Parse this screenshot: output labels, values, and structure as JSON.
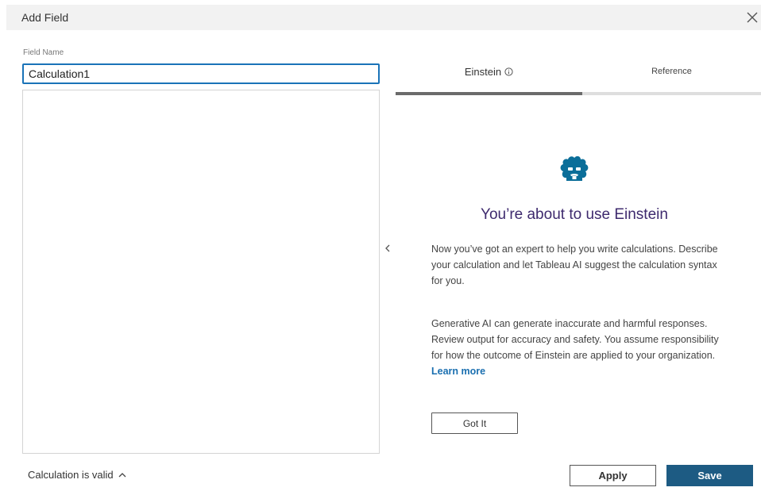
{
  "dialog": {
    "title": "Add Field",
    "close_icon": "close-icon"
  },
  "field": {
    "label": "Field Name",
    "value": "Calculation1"
  },
  "tabs": [
    {
      "label": "Einstein",
      "icon": "info-icon",
      "selected": true
    },
    {
      "label": "Reference",
      "selected": false
    }
  ],
  "einstein": {
    "logo_icon": "einstein-logo-icon",
    "heading": "You’re about to use Einstein",
    "paragraph1": "Now you’ve got an expert to help you write calculations. Describe your calculation and let Tableau AI suggest the calculation syntax for you.",
    "paragraph2": "Generative AI can generate inaccurate and harmful responses. Review output for accuracy and safety. You assume responsibility for how the outcome of Einstein are applied to your organization.",
    "learn_more": "Learn more",
    "got_it_label": "Got It"
  },
  "collapse_icon": "chevron-left-icon",
  "status": {
    "text": "Calculation is valid",
    "icon": "chevron-up-icon"
  },
  "buttons": {
    "apply": "Apply",
    "save": "Save"
  },
  "colors": {
    "accent": "#1a73b8",
    "save": "#1d5b83",
    "heading": "#3e2a6e",
    "einstein_logo": "#0b6e99",
    "link": "#1a6fb0"
  }
}
